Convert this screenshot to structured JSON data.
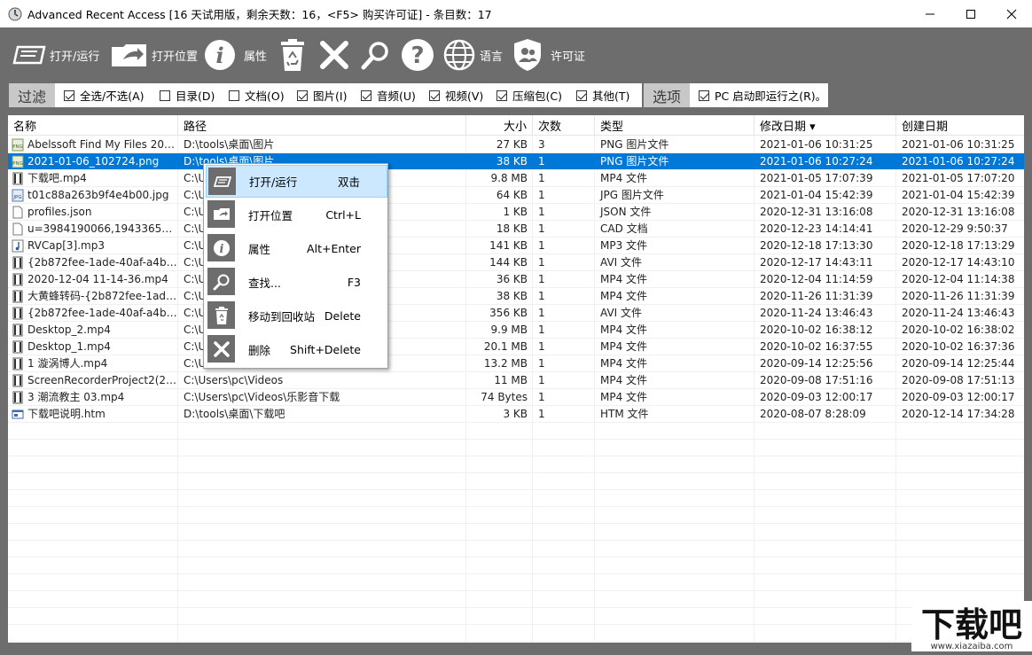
{
  "window": {
    "title": "Advanced Recent Access [16 天试用版，剩余天数：16，<F5> 购买许可证] - 条目数：17"
  },
  "toolbar": {
    "open_run": "打开/运行",
    "open_location": "打开位置",
    "properties": "属性",
    "language": "语言",
    "license": "许可证"
  },
  "filter": {
    "tag": "过滤",
    "items": [
      {
        "label": "全选/不选(A)",
        "checked": true
      },
      {
        "label": "目录(D)",
        "checked": false
      },
      {
        "label": "文档(O)",
        "checked": false
      },
      {
        "label": "图片(I)",
        "checked": true
      },
      {
        "label": "音频(U)",
        "checked": true
      },
      {
        "label": "视频(V)",
        "checked": true
      },
      {
        "label": "压缩包(C)",
        "checked": true
      },
      {
        "label": "其他(T)",
        "checked": true
      }
    ],
    "options_tag": "选项",
    "options_item": {
      "label": "PC 启动即运行之(R)。",
      "checked": true
    }
  },
  "columns": {
    "name": "名称",
    "path": "路径",
    "size": "大小",
    "count": "次数",
    "type": "类型",
    "modified": "修改日期 ▾",
    "created": "创建日期"
  },
  "rows": [
    {
      "name": "Abelssoft Find My Files 2019 1...",
      "path": "D:\\tools\\桌面\\图片",
      "size": "27 KB",
      "count": "3",
      "type": "PNG 图片文件",
      "modified": "2021-01-06 10:31:25",
      "created": "2021-01-06 10:31:25",
      "icon": "png-icon"
    },
    {
      "name": "2021-01-06_102724.png",
      "path": "D:\\tools\\桌面\\图片",
      "size": "38 KB",
      "count": "1",
      "type": "PNG 图片文件",
      "modified": "2021-01-06 10:27:24",
      "created": "2021-01-06 10:27:24",
      "icon": "png-icon"
    },
    {
      "name": "下载吧.mp4",
      "path": "C:\\U",
      "size": "9.8 MB",
      "count": "1",
      "type": "MP4 文件",
      "modified": "2021-01-05 17:07:39",
      "created": "2021-01-05 17:07:20",
      "icon": "video-icon"
    },
    {
      "name": "t01c88a263b9f4e4b00.jpg",
      "path": "C:\\U",
      "size": "64 KB",
      "count": "1",
      "type": "JPG 图片文件",
      "modified": "2021-01-04 15:42:39",
      "created": "2021-01-04 15:42:39",
      "icon": "jpg-icon"
    },
    {
      "name": "profiles.json",
      "path": "C:\\U                                          osoft.Window...",
      "size": "1 KB",
      "count": "1",
      "type": "JSON 文件",
      "modified": "2020-12-31 13:16:08",
      "created": "2020-12-31 13:16:08",
      "icon": "doc-icon"
    },
    {
      "name": "u=3984190066,1943365117&f...",
      "path": "C:\\U",
      "size": "18 KB",
      "count": "1",
      "type": "CAD 文档",
      "modified": "2020-12-23 14:14:41",
      "created": "2020-12-29 9:50:37",
      "icon": "doc-icon"
    },
    {
      "name": "RVCap[3].mp3",
      "path": "C:\\U",
      "size": "141 KB",
      "count": "1",
      "type": "MP3 文件",
      "modified": "2020-12-18 17:13:30",
      "created": "2020-12-18 17:13:29",
      "icon": "audio-icon"
    },
    {
      "name": "{2b872fee-1ade-40af-a4b2-9f...",
      "path": "C:\\U",
      "size": "144 KB",
      "count": "1",
      "type": "AVI 文件",
      "modified": "2020-12-17 14:43:11",
      "created": "2020-12-17 14:43:10",
      "icon": "video-icon"
    },
    {
      "name": "2020-12-04 11-14-36.mp4",
      "path": "C:\\U",
      "size": "36 KB",
      "count": "1",
      "type": "MP4 文件",
      "modified": "2020-12-04 11:14:59",
      "created": "2020-12-04 11:14:38",
      "icon": "video-icon"
    },
    {
      "name": "大黄蜂转码-{2b872fee-1ade-...",
      "path": "C:\\U",
      "size": "38 KB",
      "count": "1",
      "type": "MP4 文件",
      "modified": "2020-11-26 11:31:39",
      "created": "2020-11-26 11:31:39",
      "icon": "video-icon"
    },
    {
      "name": "{2b872fee-1ade-40af-a4b2-9f...",
      "path": "C:\\U",
      "size": "356 KB",
      "count": "1",
      "type": "AVI 文件",
      "modified": "2020-11-24 13:46:43",
      "created": "2020-11-24 13:46:43",
      "icon": "video-icon"
    },
    {
      "name": "Desktop_2.mp4",
      "path": "C:\\U",
      "size": "9.9 MB",
      "count": "1",
      "type": "MP4 文件",
      "modified": "2020-10-02 16:38:12",
      "created": "2020-10-02 16:38:02",
      "icon": "video-icon"
    },
    {
      "name": "Desktop_1.mp4",
      "path": "C:\\U",
      "size": "20.1 MB",
      "count": "1",
      "type": "MP4 文件",
      "modified": "2020-10-02 16:37:55",
      "created": "2020-10-02 16:37:36",
      "icon": "video-icon"
    },
    {
      "name": "1 漩涡博人.mp4",
      "path": "C:\\U",
      "size": "13.2 MB",
      "count": "1",
      "type": "MP4 文件",
      "modified": "2020-09-14 12:25:56",
      "created": "2020-09-14 12:25:44",
      "icon": "video-icon"
    },
    {
      "name": "ScreenRecorderProject2(2020...",
      "path": "C:\\Users\\pc\\Videos",
      "size": "11 MB",
      "count": "1",
      "type": "MP4 文件",
      "modified": "2020-09-08 17:51:16",
      "created": "2020-09-08 17:51:13",
      "icon": "video-icon"
    },
    {
      "name": "3 潮流教主 03.mp4",
      "path": "C:\\Users\\pc\\Videos\\乐影音下载",
      "size": "74 Bytes",
      "count": "1",
      "type": "MP4 文件",
      "modified": "2020-09-03 12:00:17",
      "created": "2020-09-03 12:00:17",
      "icon": "video-icon"
    },
    {
      "name": "下载吧说明.htm",
      "path": "D:\\tools\\桌面\\下载吧",
      "size": "3 KB",
      "count": "1",
      "type": "HTM 文件",
      "modified": "2020-08-07 8:28:09",
      "created": "2020-12-14 17:34:28",
      "icon": "html-icon"
    }
  ],
  "context_menu": {
    "items": [
      {
        "label": "打开/运行",
        "key": "双击"
      },
      {
        "label": "打开位置",
        "key": "Ctrl+L"
      },
      {
        "label": "属性",
        "key": "Alt+Enter"
      },
      {
        "label": "查找...",
        "key": "F3"
      },
      {
        "label": "移动到回收站",
        "key": "Delete"
      },
      {
        "label": "删除",
        "key": "Shift+Delete"
      }
    ]
  },
  "watermark": {
    "logo_text": "下载吧",
    "url_text": "www.xiazaiba.com"
  },
  "colors": {
    "toolbar_bg": "#6d6d6d",
    "selection": "#0078d7",
    "menu_highlight": "#cce8ff"
  }
}
